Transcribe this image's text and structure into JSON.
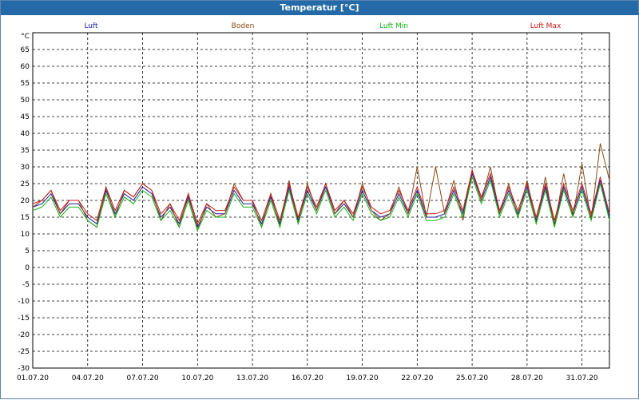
{
  "window": {
    "title": "Temperatur [°C]"
  },
  "chart_data": {
    "type": "line",
    "title": "Temperatur [°C]",
    "ylabel": "°C",
    "ylim": [
      -30,
      70
    ],
    "yticks": [
      -30,
      -25,
      -20,
      -15,
      -10,
      -5,
      0,
      5,
      10,
      15,
      20,
      25,
      30,
      35,
      40,
      45,
      50,
      55,
      60,
      65
    ],
    "xlim": [
      "01.07.20",
      "01.08.20 12:00"
    ],
    "xtick_labels": [
      "01.07.20",
      "04.07.20",
      "07.07.20",
      "10.07.20",
      "13.07.20",
      "16.07.20",
      "19.07.20",
      "22.07.20",
      "25.07.20",
      "28.07.20",
      "31.07.20"
    ],
    "grid": true,
    "legend_placement": "top",
    "series": [
      {
        "name": "Luft",
        "color": "#1a1aa0",
        "x": [
          "01.07.20 00:00",
          "01.07.20 12:00",
          "02.07.20 00:00",
          "02.07.20 12:00",
          "03.07.20 00:00",
          "03.07.20 12:00",
          "04.07.20 00:00",
          "04.07.20 12:00",
          "05.07.20 00:00",
          "05.07.20 12:00",
          "06.07.20 00:00",
          "06.07.20 12:00",
          "07.07.20 00:00",
          "07.07.20 12:00",
          "08.07.20 00:00",
          "08.07.20 12:00",
          "09.07.20 00:00",
          "09.07.20 12:00",
          "10.07.20 00:00",
          "10.07.20 12:00",
          "11.07.20 00:00",
          "11.07.20 12:00",
          "12.07.20 00:00",
          "12.07.20 12:00",
          "13.07.20 00:00",
          "13.07.20 12:00",
          "14.07.20 00:00",
          "14.07.20 12:00",
          "15.07.20 00:00",
          "15.07.20 12:00",
          "16.07.20 00:00",
          "16.07.20 12:00",
          "17.07.20 00:00",
          "17.07.20 12:00",
          "18.07.20 00:00",
          "18.07.20 12:00",
          "19.07.20 00:00",
          "19.07.20 12:00",
          "20.07.20 00:00",
          "20.07.20 12:00",
          "21.07.20 00:00",
          "21.07.20 12:00",
          "22.07.20 00:00",
          "22.07.20 12:00",
          "23.07.20 00:00",
          "23.07.20 12:00",
          "24.07.20 00:00",
          "24.07.20 12:00",
          "25.07.20 00:00",
          "25.07.20 12:00",
          "26.07.20 00:00",
          "26.07.20 12:00",
          "27.07.20 00:00",
          "27.07.20 12:00",
          "28.07.20 00:00",
          "28.07.20 12:00",
          "29.07.20 00:00",
          "29.07.20 12:00",
          "30.07.20 00:00",
          "30.07.20 12:00",
          "31.07.20 00:00",
          "31.07.20 12:00",
          "01.08.20 00:00",
          "01.08.20 12:00"
        ],
        "y": [
          18,
          19,
          22,
          16,
          19,
          19,
          15,
          13,
          23,
          16,
          22,
          20,
          24,
          22,
          15,
          18,
          13,
          21,
          12,
          18,
          16,
          16,
          23,
          19,
          19,
          13,
          21,
          13,
          24,
          14,
          23,
          17,
          24,
          16,
          19,
          15,
          23,
          17,
          15,
          16,
          22,
          16,
          23,
          15,
          15,
          16,
          23,
          16,
          28,
          20,
          27,
          16,
          23,
          16,
          24,
          14,
          24,
          13,
          24,
          16,
          24,
          15,
          26,
          15
        ]
      },
      {
        "name": "Boden",
        "color": "#8b4a14",
        "x": [
          "01.07.20 00:00",
          "01.07.20 12:00",
          "02.07.20 00:00",
          "02.07.20 12:00",
          "03.07.20 00:00",
          "03.07.20 12:00",
          "04.07.20 00:00",
          "04.07.20 12:00",
          "05.07.20 00:00",
          "05.07.20 12:00",
          "06.07.20 00:00",
          "06.07.20 12:00",
          "07.07.20 00:00",
          "07.07.20 12:00",
          "08.07.20 00:00",
          "08.07.20 12:00",
          "09.07.20 00:00",
          "09.07.20 12:00",
          "10.07.20 00:00",
          "10.07.20 12:00",
          "11.07.20 00:00",
          "11.07.20 12:00",
          "12.07.20 00:00",
          "12.07.20 12:00",
          "13.07.20 00:00",
          "13.07.20 12:00",
          "14.07.20 00:00",
          "14.07.20 12:00",
          "15.07.20 00:00",
          "15.07.20 12:00",
          "16.07.20 00:00",
          "16.07.20 12:00",
          "17.07.20 00:00",
          "17.07.20 12:00",
          "18.07.20 00:00",
          "18.07.20 12:00",
          "19.07.20 00:00",
          "19.07.20 12:00",
          "20.07.20 00:00",
          "20.07.20 12:00",
          "21.07.20 00:00",
          "21.07.20 12:00",
          "22.07.20 00:00",
          "22.07.20 12:00",
          "23.07.20 00:00",
          "23.07.20 12:00",
          "24.07.20 00:00",
          "24.07.20 12:00",
          "25.07.20 00:00",
          "25.07.20 12:00",
          "26.07.20 00:00",
          "26.07.20 12:00",
          "27.07.20 00:00",
          "27.07.20 12:00",
          "28.07.20 00:00",
          "28.07.20 12:00",
          "29.07.20 00:00",
          "29.07.20 12:00",
          "30.07.20 00:00",
          "30.07.20 12:00",
          "31.07.20 00:00",
          "31.07.20 12:00",
          "01.08.20 00:00",
          "01.08.20 12:00"
        ],
        "y": [
          18,
          20,
          23,
          16,
          20,
          20,
          14,
          12,
          24,
          15,
          23,
          21,
          25,
          23,
          14,
          19,
          12,
          22,
          11,
          19,
          15,
          16,
          25,
          20,
          20,
          12,
          22,
          12,
          26,
          13,
          25,
          17,
          25,
          16,
          20,
          15,
          25,
          17,
          14,
          16,
          24,
          16,
          30,
          15,
          30,
          16,
          26,
          14,
          29,
          20,
          30,
          16,
          25,
          15,
          26,
          13,
          27,
          12,
          28,
          15,
          31,
          14,
          37,
          26
        ]
      },
      {
        "name": "Luft Min",
        "color": "#16b516",
        "x": [
          "01.07.20 00:00",
          "01.07.20 12:00",
          "02.07.20 00:00",
          "02.07.20 12:00",
          "03.07.20 00:00",
          "03.07.20 12:00",
          "04.07.20 00:00",
          "04.07.20 12:00",
          "05.07.20 00:00",
          "05.07.20 12:00",
          "06.07.20 00:00",
          "06.07.20 12:00",
          "07.07.20 00:00",
          "07.07.20 12:00",
          "08.07.20 00:00",
          "08.07.20 12:00",
          "09.07.20 00:00",
          "09.07.20 12:00",
          "10.07.20 00:00",
          "10.07.20 12:00",
          "11.07.20 00:00",
          "11.07.20 12:00",
          "12.07.20 00:00",
          "12.07.20 12:00",
          "13.07.20 00:00",
          "13.07.20 12:00",
          "14.07.20 00:00",
          "14.07.20 12:00",
          "15.07.20 00:00",
          "15.07.20 12:00",
          "16.07.20 00:00",
          "16.07.20 12:00",
          "17.07.20 00:00",
          "17.07.20 12:00",
          "18.07.20 00:00",
          "18.07.20 12:00",
          "19.07.20 00:00",
          "19.07.20 12:00",
          "20.07.20 00:00",
          "20.07.20 12:00",
          "21.07.20 00:00",
          "21.07.20 12:00",
          "22.07.20 00:00",
          "22.07.20 12:00",
          "23.07.20 00:00",
          "23.07.20 12:00",
          "24.07.20 00:00",
          "24.07.20 12:00",
          "25.07.20 00:00",
          "25.07.20 12:00",
          "26.07.20 00:00",
          "26.07.20 12:00",
          "27.07.20 00:00",
          "27.07.20 12:00",
          "28.07.20 00:00",
          "28.07.20 12:00",
          "29.07.20 00:00",
          "29.07.20 12:00",
          "30.07.20 00:00",
          "30.07.20 12:00",
          "31.07.20 00:00",
          "31.07.20 12:00",
          "01.08.20 00:00",
          "01.08.20 12:00"
        ],
        "y": [
          17,
          18,
          21,
          15,
          18,
          18,
          14,
          12,
          22,
          15,
          21,
          19,
          23,
          21,
          14,
          17,
          12,
          20,
          11,
          17,
          15,
          15,
          22,
          18,
          18,
          12,
          20,
          12,
          23,
          13,
          22,
          16,
          23,
          15,
          18,
          14,
          22,
          16,
          14,
          15,
          21,
          15,
          22,
          14,
          14,
          15,
          22,
          15,
          27,
          19,
          26,
          15,
          22,
          15,
          23,
          13,
          23,
          12,
          23,
          15,
          23,
          14,
          25,
          14
        ]
      },
      {
        "name": "Luft Max",
        "color": "#c81818",
        "x": [
          "01.07.20 00:00",
          "01.07.20 12:00",
          "02.07.20 00:00",
          "02.07.20 12:00",
          "03.07.20 00:00",
          "03.07.20 12:00",
          "04.07.20 00:00",
          "04.07.20 12:00",
          "05.07.20 00:00",
          "05.07.20 12:00",
          "06.07.20 00:00",
          "06.07.20 12:00",
          "07.07.20 00:00",
          "07.07.20 12:00",
          "08.07.20 00:00",
          "08.07.20 12:00",
          "09.07.20 00:00",
          "09.07.20 12:00",
          "10.07.20 00:00",
          "10.07.20 12:00",
          "11.07.20 00:00",
          "11.07.20 12:00",
          "12.07.20 00:00",
          "12.07.20 12:00",
          "13.07.20 00:00",
          "13.07.20 12:00",
          "14.07.20 00:00",
          "14.07.20 12:00",
          "15.07.20 00:00",
          "15.07.20 12:00",
          "16.07.20 00:00",
          "16.07.20 12:00",
          "17.07.20 00:00",
          "17.07.20 12:00",
          "18.07.20 00:00",
          "18.07.20 12:00",
          "19.07.20 00:00",
          "19.07.20 12:00",
          "20.07.20 00:00",
          "20.07.20 12:00",
          "21.07.20 00:00",
          "21.07.20 12:00",
          "22.07.20 00:00",
          "22.07.20 12:00",
          "23.07.20 00:00",
          "23.07.20 12:00",
          "24.07.20 00:00",
          "24.07.20 12:00",
          "25.07.20 00:00",
          "25.07.20 12:00",
          "26.07.20 00:00",
          "26.07.20 12:00",
          "27.07.20 00:00",
          "27.07.20 12:00",
          "28.07.20 00:00",
          "28.07.20 12:00",
          "29.07.20 00:00",
          "29.07.20 12:00",
          "30.07.20 00:00",
          "30.07.20 12:00",
          "31.07.20 00:00",
          "31.07.20 12:00",
          "01.08.20 00:00",
          "01.08.20 12:00"
        ],
        "y": [
          19,
          20,
          23,
          17,
          20,
          20,
          16,
          14,
          24,
          17,
          23,
          21,
          25,
          23,
          16,
          19,
          14,
          22,
          13,
          19,
          17,
          17,
          24,
          20,
          20,
          14,
          22,
          14,
          25,
          15,
          24,
          18,
          25,
          17,
          20,
          16,
          24,
          18,
          16,
          17,
          23,
          17,
          24,
          16,
          16,
          17,
          24,
          17,
          29,
          21,
          28,
          17,
          24,
          17,
          25,
          15,
          25,
          14,
          25,
          17,
          25,
          16,
          27,
          16
        ]
      }
    ]
  }
}
